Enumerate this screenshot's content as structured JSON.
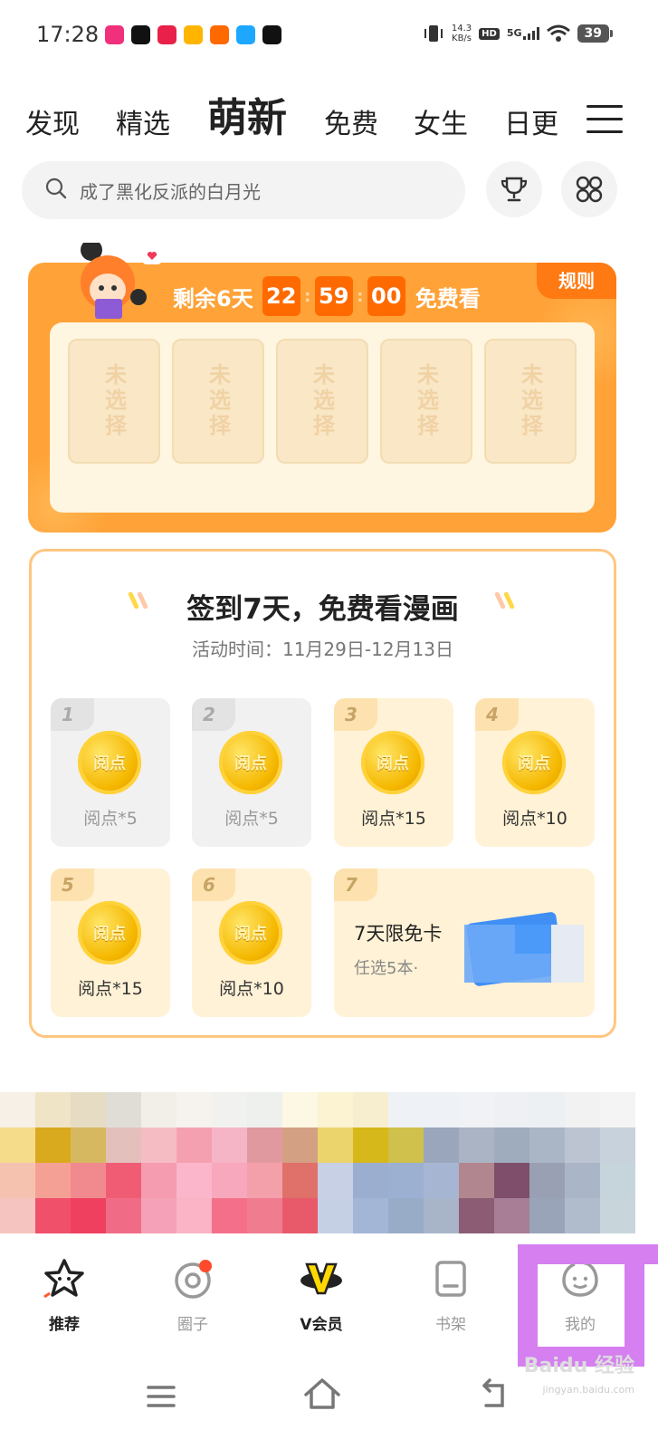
{
  "status_bar": {
    "time": "17:28",
    "net_speed_value": "14.3",
    "net_speed_unit": "KB/s",
    "hd_label": "HD",
    "signal_label": "5G",
    "battery": "39",
    "notif_colors": [
      "#f0307a",
      "#111111",
      "#e8204a",
      "#ffb400",
      "#ff6a00",
      "#1ea7ff",
      "#111111"
    ]
  },
  "category_tabs": [
    {
      "label": "发现",
      "active": false
    },
    {
      "label": "精选",
      "active": false
    },
    {
      "label": "萌新",
      "active": true
    },
    {
      "label": "免费",
      "active": false
    },
    {
      "label": "女生",
      "active": false
    },
    {
      "label": "日更",
      "active": false
    }
  ],
  "search": {
    "placeholder": "成了黑化反派的白月光"
  },
  "free_card": {
    "rule_label": "规则",
    "countdown_prefix": "剩余6天",
    "hours": "22",
    "minutes": "59",
    "seconds": "00",
    "countdown_suffix": "免费看",
    "slot_label": "未选择",
    "slots": [
      "未选择",
      "未选择",
      "未选择",
      "未选择",
      "未选择"
    ]
  },
  "sign_in": {
    "title": "签到7天，免费看漫画",
    "time": "活动时间：11月29日-12月13日",
    "coin_text": "阅点",
    "days": [
      {
        "day": "1",
        "reward": "阅点*5",
        "state": "done"
      },
      {
        "day": "2",
        "reward": "阅点*5",
        "state": "done"
      },
      {
        "day": "3",
        "reward": "阅点*15",
        "state": "todo"
      },
      {
        "day": "4",
        "reward": "阅点*10",
        "state": "todo"
      },
      {
        "day": "5",
        "reward": "阅点*15",
        "state": "todo"
      },
      {
        "day": "6",
        "reward": "阅点*10",
        "state": "todo"
      },
      {
        "day": "7",
        "reward": "7天限免卡",
        "sub": "任选5本·",
        "state": "todo"
      }
    ]
  },
  "bottom_nav": [
    {
      "label": "推荐",
      "icon": "star-face-icon",
      "active": true
    },
    {
      "label": "圈子",
      "icon": "circle-icon",
      "active": false,
      "dot": true
    },
    {
      "label": "V会员",
      "icon": "vip-planet-icon",
      "active": true
    },
    {
      "label": "书架",
      "icon": "bookshelf-icon",
      "active": false
    },
    {
      "label": "我的",
      "icon": "profile-face-icon",
      "active": false
    }
  ],
  "watermark": {
    "text": "Baidu 经验",
    "url_text": "jingyan.baidu.com"
  },
  "colors": {
    "accent_orange": "#ffa237",
    "countdown_box": "#ff6a00",
    "highlight_purple": "#d57ff0"
  }
}
